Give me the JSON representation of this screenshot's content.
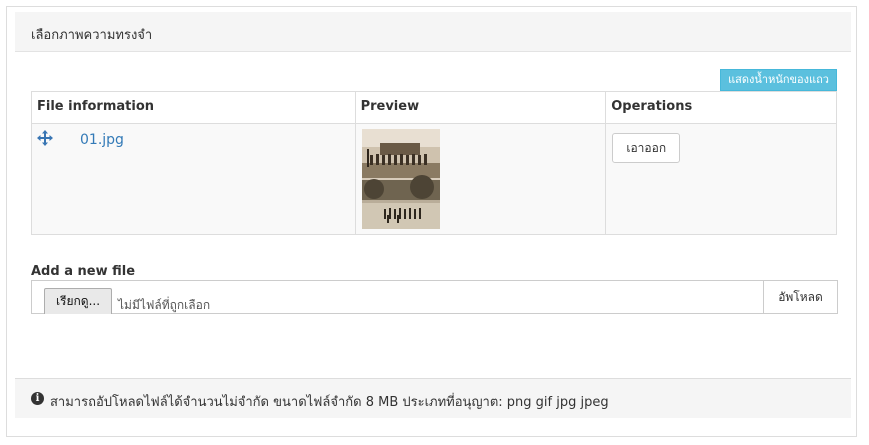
{
  "panel": {
    "title": "เลือกภาพความทรงจำ"
  },
  "table": {
    "show_weights_label": "แสดงน้ำหนักของแถว",
    "headers": {
      "info": "File information",
      "preview": "Preview",
      "operations": "Operations"
    },
    "rows": [
      {
        "filename": "01.jpg",
        "remove_label": "เอาออก"
      }
    ]
  },
  "add_file": {
    "label": "Add a new file",
    "browse_label": "เรียกดู...",
    "no_file_text": "ไม่มีไฟล์ที่ถูกเลือก",
    "upload_label": "อัพโหลด"
  },
  "footer": {
    "help_text": "สามารถอัปโหลดไฟล์ได้จำนวนไม่จำกัด ขนาดไฟล์จำกัด 8 MB ประเภทที่อนุญาต: png gif jpg jpeg"
  },
  "colors": {
    "link": "#337ab7",
    "info_button": "#5bc0de"
  }
}
